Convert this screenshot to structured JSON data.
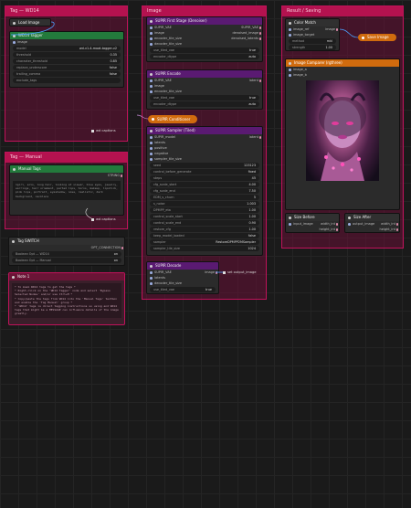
{
  "groups": {
    "group1": "Tag — WD14",
    "group2": "Tag — Manual",
    "group3": "Image",
    "group4": "Result / Saving"
  },
  "wd14": {
    "load_image": "Load Image",
    "tagger_title": "WD14 Tagger",
    "tagger_rows": [
      {
        "k": "image",
        "v": ""
      },
      {
        "k": "model",
        "v": "wd-v1-4-moat-tagger-v2"
      },
      {
        "k": "threshold",
        "v": "0.35"
      },
      {
        "k": "character_threshold",
        "v": "0.85"
      },
      {
        "k": "replace_underscore",
        "v": "false"
      },
      {
        "k": "trailing_comma",
        "v": "false"
      },
      {
        "k": "exclude_tags",
        "v": ""
      }
    ],
    "output_badge": "wd captions"
  },
  "manual": {
    "title": "Manual Tags",
    "output": "STRING",
    "text": "1girl, solo, long hair, looking at viewer, blue eyes, jewelry, earrings, hair ornament, parted lips, horns, makeup, lipstick, pink lips, portrait, eyeshadow, nose, realistic, dark background, necklace",
    "output_badge": "wd captions"
  },
  "switch": {
    "title": "Tag SWITCH",
    "out": "OPT_CONNECTION",
    "rows": [
      {
        "k": "Boolean Opt — WD14",
        "v": "on"
      },
      {
        "k": "Boolean Opt — Manual",
        "v": "on"
      }
    ]
  },
  "note": {
    "title": "Note 1",
    "text": "* To mask WD14 tags to get the tags *\n* Right-click on the 'WD14 Tagger' node and select 'Bypass Selected Nodes' and/or use Ctrl+M *\n* Copy/paste the tags from WD14 into the 'Manual Tags' textbox and enable the 'Tag Manual' group *\n* 'WD14' tags is direct tagging instructions so using and WD14 tags that might be a MESSAGE can influence details of the image greatly."
  },
  "first_stage": {
    "title": "SUPIR First Stage (Denoiser)",
    "rows": [
      {
        "k": "SUPIR_VAE",
        "v": "SUPIR_VAE"
      },
      {
        "k": "image",
        "v": "denoised_image"
      },
      {
        "k": "encoder_tile_size",
        "v": "denoised_latents"
      },
      {
        "k": "decoder_tile_size",
        "v": ""
      }
    ],
    "widgets": [
      {
        "k": "use_tiled_vae",
        "v": "true"
      },
      {
        "k": "encoder_dtype",
        "v": "auto"
      }
    ]
  },
  "encode": {
    "title": "SUPIR Encode",
    "rows": [
      {
        "k": "SUPIR_VAE",
        "v": "latent"
      },
      {
        "k": "image",
        "v": ""
      },
      {
        "k": "encoder_tile_size",
        "v": ""
      }
    ],
    "widgets": [
      {
        "k": "use_tiled_vae",
        "v": "true"
      },
      {
        "k": "encoder_dtype",
        "v": "auto"
      }
    ]
  },
  "conditioner": {
    "label": "SUPIR Conditioner"
  },
  "sampler": {
    "title": "SUPIR Sampler (Tiled)",
    "rows": [
      {
        "k": "SUPIR_model",
        "v": "latent"
      },
      {
        "k": "latents",
        "v": ""
      },
      {
        "k": "positive",
        "v": ""
      },
      {
        "k": "negative",
        "v": ""
      },
      {
        "k": "sampler_tile_size",
        "v": ""
      }
    ],
    "widgets": [
      {
        "k": "seed",
        "v": "123123"
      },
      {
        "k": "control_before_generate",
        "v": "fixed"
      },
      {
        "k": "steps",
        "v": "45"
      },
      {
        "k": "cfg_scale_start",
        "v": "4.00"
      },
      {
        "k": "cfg_scale_end",
        "v": "7.50"
      },
      {
        "k": "EDM_s_churn",
        "v": "5"
      },
      {
        "k": "s_noise",
        "v": "1.003"
      },
      {
        "k": "DPMPP_eta",
        "v": "1.00"
      },
      {
        "k": "control_scale_start",
        "v": "1.00"
      },
      {
        "k": "control_scale_end",
        "v": "0.90"
      },
      {
        "k": "restore_cfg",
        "v": "1.00"
      },
      {
        "k": "keep_model_loaded",
        "v": "false"
      },
      {
        "k": "sampler",
        "v": "RestoreDPMPP2MSampler"
      },
      {
        "k": "sampler_tile_size",
        "v": "1024"
      }
    ]
  },
  "decode": {
    "title": "SUPIR Decode",
    "rows": [
      {
        "k": "SUPIR_VAE",
        "v": "image"
      },
      {
        "k": "latents",
        "v": ""
      },
      {
        "k": "decoder_tile_size",
        "v": ""
      }
    ],
    "widgets": [
      {
        "k": "use_tiled_vae",
        "v": "true"
      }
    ],
    "output_badge": "set output_image"
  },
  "color_match": {
    "title": "Color Match",
    "rows": [
      {
        "k": "image_ref",
        "v": "image"
      },
      {
        "k": "image_target",
        "v": ""
      }
    ],
    "widgets": [
      {
        "k": "method",
        "v": "mkl"
      },
      {
        "k": "strength",
        "v": "1.00"
      }
    ],
    "save_label": "Save Image"
  },
  "compare": {
    "title": "Image Comparer (rgthree)",
    "rows": [
      {
        "k": "image_a",
        "v": ""
      },
      {
        "k": "image_b",
        "v": ""
      }
    ]
  },
  "size_before": {
    "title": "Size Before",
    "rows": [
      {
        "k": "input_image",
        "v": "width_int"
      },
      {
        "k": "",
        "v": "height_int"
      }
    ]
  },
  "size_after": {
    "title": "Size After",
    "rows": [
      {
        "k": "output_image",
        "v": "width_int"
      },
      {
        "k": "",
        "v": "height_int"
      }
    ]
  },
  "colors": {
    "group_border": "#c0125a",
    "group_title": "#b4124f",
    "node_purple": "#5a1a72",
    "node_green": "#237a3c",
    "node_orange": "#d06b0e",
    "wire_blue": "#4aa3ff"
  }
}
